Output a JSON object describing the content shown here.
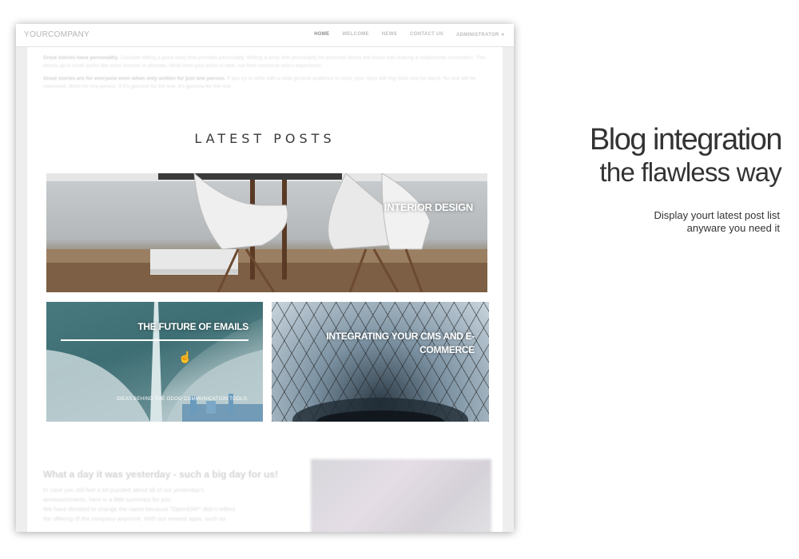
{
  "navbar": {
    "brand": "YOURCOMPANY",
    "items": [
      "HOME",
      "WELCOME",
      "NEWS",
      "CONTACT US"
    ],
    "admin": "ADMINISTRATOR"
  },
  "intro": {
    "p1_bold": "Great stories have personality.",
    "p1_text": " Consider telling a great story that provides personality. Writing a story with personality for potential clients will assist with making a relationship connection. This shows up in small quirks like word choices or phrases. Write from your point of view, not from someone else's experience.",
    "p2_bold": "Great stories are for everyone even when only written for just one person.",
    "p2_text": " If you try to write with a wide general audience in mind, your story will ring false and be bland. No one will be interested. Write for one person. If it's genuine for the one, it's genuine for the rest."
  },
  "section_title": "LATEST POSTS",
  "posts": [
    {
      "title": "INTERIOR DESIGN"
    },
    {
      "title": "THE FUTURE OF EMAILS",
      "subtitle": "IDEAS BEHIND THE ODOO COMMUNICATION TOOLS."
    },
    {
      "title": "INTEGRATING YOUR CMS AND E-COMMERCE"
    }
  ],
  "article": {
    "title": "What a day it was yesterday - such a big day for us!",
    "lines": [
      "In case you still feel a bit puzzled about all of our yesterday's",
      "announcements, here is a little summary for you.",
      "We have decided to change the name because \"OpenERP\" didn't reflect",
      "the offering of the company anymore. With our newest apps, such as"
    ]
  },
  "marketing": {
    "headline": "Blog integration",
    "subheadline": "the flawless way",
    "description_line1": "Display yourt latest post list",
    "description_line2": "anyware you need it"
  }
}
